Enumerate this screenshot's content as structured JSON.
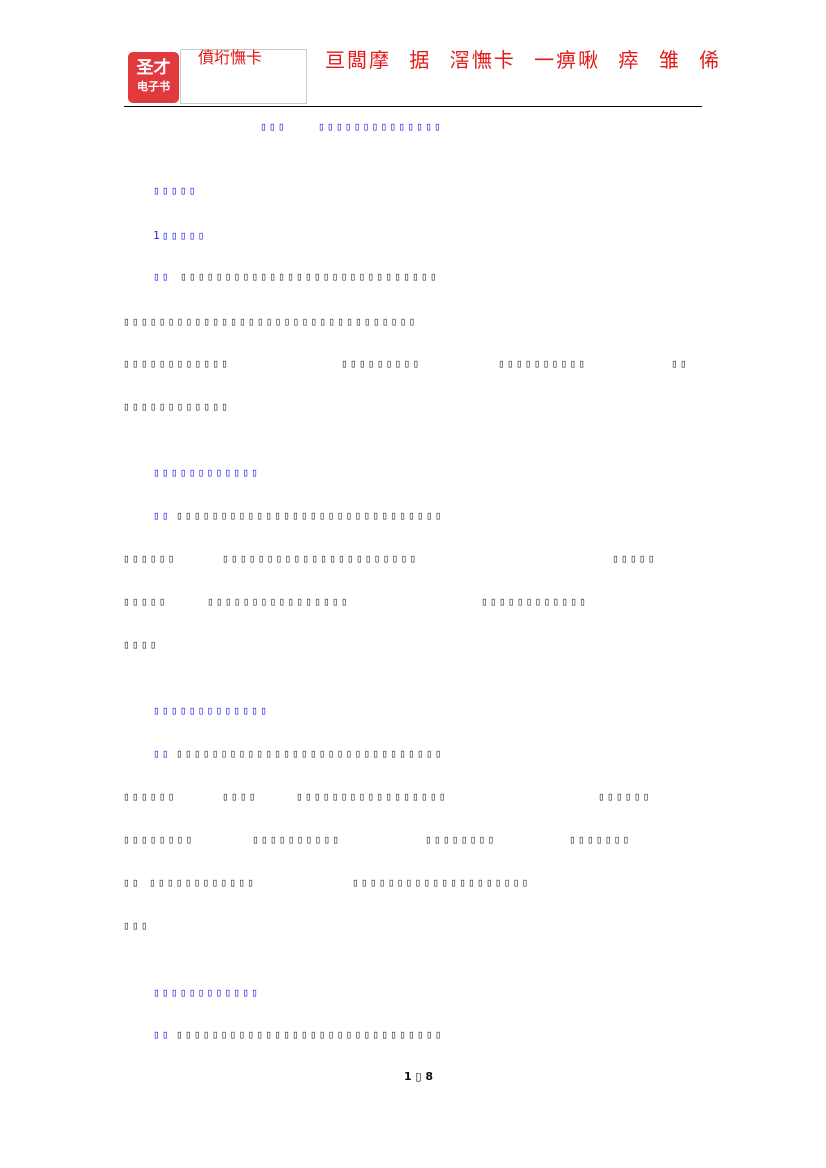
{
  "header": {
    "logo_line1": "圣才",
    "logo_line2": "电子书",
    "small_title": "僨垳憮卡",
    "big_title": "亘闆摩 据 滘憮卡 一痹啾 瘁 雏 俙"
  },
  "lines": [
    [
      "▯▯▯",
      "▯▯▯▯▯▯▯▯▯▯▯▯▯▯"
    ],
    [
      "▯▯▯▯▯"
    ],
    [
      "1▯▯▯▯▯"
    ],
    [
      "▯▯",
      "▯▯▯▯▯▯▯▯▯▯▯▯▯▯▯▯▯▯▯▯▯▯▯▯▯▯▯▯▯"
    ],
    [
      "▯▯▯▯▯▯▯▯▯▯▯▯▯▯▯▯▯▯▯▯▯▯▯▯▯▯▯▯▯▯▯▯▯"
    ],
    [
      "▯▯▯▯▯▯▯▯▯▯▯▯",
      "▯▯▯▯▯▯▯▯▯",
      "▯▯▯▯▯▯▯▯▯▯",
      "▯▯"
    ],
    [
      "▯▯▯▯▯▯▯▯▯▯▯▯"
    ],
    [
      "▯▯▯▯▯▯▯▯▯▯▯▯"
    ],
    [
      "▯▯",
      "▯▯▯▯▯▯▯▯▯▯▯▯▯▯▯▯▯▯▯▯▯▯▯▯▯▯▯▯▯▯"
    ],
    [
      "▯▯▯▯▯▯",
      "▯▯▯▯▯▯▯▯▯▯▯▯▯▯▯▯▯▯▯▯▯▯",
      "▯▯▯▯▯"
    ],
    [
      "▯▯▯▯▯",
      "▯▯▯▯▯▯▯▯▯▯▯▯▯▯▯▯",
      "▯▯▯▯▯▯▯▯▯▯▯▯"
    ],
    [
      "▯▯▯▯"
    ],
    [
      "▯▯▯▯▯▯▯▯▯▯▯▯▯"
    ],
    [
      "▯▯",
      "▯▯▯▯▯▯▯▯▯▯▯▯▯▯▯▯▯▯▯▯▯▯▯▯▯▯▯▯▯▯"
    ],
    [
      "▯▯▯▯▯▯",
      "▯▯▯▯",
      "▯▯▯▯▯▯▯▯▯▯▯▯▯▯▯▯▯",
      "▯▯▯▯▯▯"
    ],
    [
      "▯▯▯▯▯▯▯▯",
      "▯▯▯▯▯▯▯▯▯▯",
      "▯▯▯▯▯▯▯▯",
      "▯▯▯▯▯▯▯"
    ],
    [
      "▯▯",
      "▯▯▯▯▯▯▯▯▯▯▯▯",
      "▯▯▯▯▯▯▯▯▯▯▯▯▯▯▯▯▯▯▯▯"
    ],
    [
      "▯▯▯"
    ],
    [
      "▯▯▯▯▯▯▯▯▯▯▯▯"
    ],
    [
      "▯▯",
      "▯▯▯▯▯▯▯▯▯▯▯▯▯▯▯▯▯▯▯▯▯▯▯▯▯▯▯▯▯▯"
    ]
  ],
  "footer": {
    "page": "1 ▯ 8"
  },
  "colors": {
    "heading": "#2222ee",
    "body": "#333333",
    "brand": "#e41a1a"
  }
}
